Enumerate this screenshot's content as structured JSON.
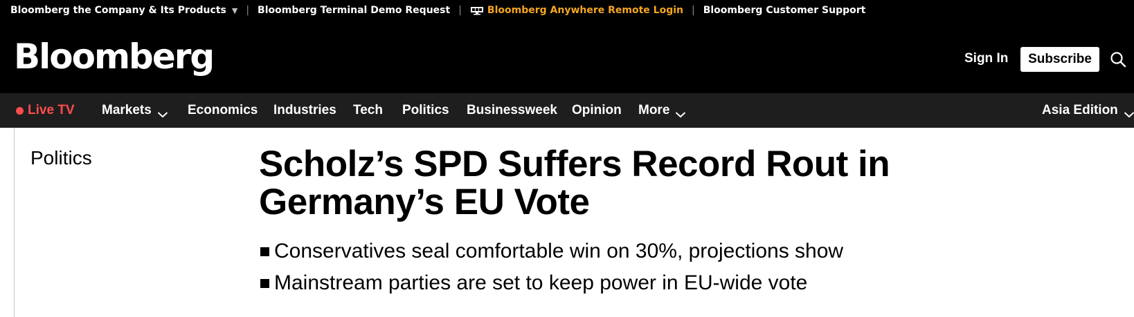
{
  "topbar": {
    "company": "Bloomberg the Company & Its Products",
    "terminal_demo": "Bloomberg Terminal Demo Request",
    "anywhere": "Bloomberg Anywhere Remote Login",
    "support": "Bloomberg Customer Support",
    "accent_color": "#f5a623"
  },
  "masthead": {
    "logo": "Bloomberg",
    "sign_in": "Sign In",
    "subscribe": "Subscribe"
  },
  "nav": {
    "live_tv": "Live TV",
    "live_color": "#ff4d4d",
    "items": [
      "Markets",
      "Economics",
      "Industries",
      "Tech",
      "Politics",
      "Businessweek",
      "Opinion",
      "More"
    ],
    "edition": "Asia Edition"
  },
  "article": {
    "section": "Politics",
    "headline": "Scholz’s SPD Suffers Record Rout in Germany’s EU Vote",
    "bullets": [
      "Conservatives seal comfortable win on 30%, projections show",
      "Mainstream parties are set to keep power in EU-wide vote"
    ]
  }
}
